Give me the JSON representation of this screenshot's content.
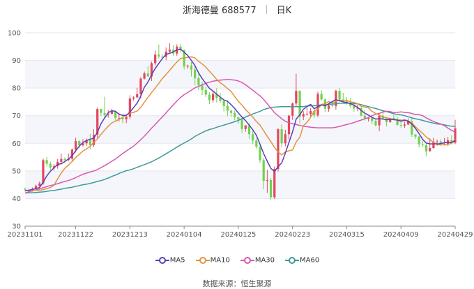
{
  "chart_data": {
    "type": "candlestick",
    "title": "浙海德曼 688577",
    "period_label": "日K",
    "source_text": "数据来源：恒生聚源",
    "ylim": [
      30,
      100
    ],
    "y_ticks": [
      30,
      40,
      50,
      60,
      70,
      80,
      90,
      100
    ],
    "x_ticks": [
      {
        "index": 0,
        "label": "20231101"
      },
      {
        "index": 14,
        "label": "20231122"
      },
      {
        "index": 29,
        "label": "20231213"
      },
      {
        "index": 44,
        "label": "20240104"
      },
      {
        "index": 59,
        "label": "20240125"
      },
      {
        "index": 74,
        "label": "20240223"
      },
      {
        "index": 89,
        "label": "20240315"
      },
      {
        "index": 104,
        "label": "20240409"
      },
      {
        "index": 119,
        "label": "20240429"
      }
    ],
    "grid": "horizontal",
    "legend_position": "bottom",
    "colors": {
      "up": "#e5465b",
      "down": "#6fd24f",
      "ma5": "#5b3db5",
      "ma10": "#e6913b",
      "ma30": "#d958b0",
      "ma60": "#3f9999"
    },
    "legend": [
      {
        "key": "ma5",
        "label": "MA5"
      },
      {
        "key": "ma10",
        "label": "MA10"
      },
      {
        "key": "ma30",
        "label": "MA30"
      },
      {
        "key": "ma60",
        "label": "MA60"
      }
    ],
    "candles": [
      [
        43.5,
        43.2,
        44.0,
        42.5
      ],
      [
        43.2,
        42.8,
        43.6,
        42.2
      ],
      [
        42.8,
        43.5,
        44.0,
        42.5
      ],
      [
        43.5,
        44.6,
        45.1,
        43.2
      ],
      [
        44.6,
        45.5,
        46.2,
        44.0
      ],
      [
        45.5,
        53.9,
        54.5,
        45.0
      ],
      [
        53.9,
        52.6,
        55.1,
        51.6
      ],
      [
        52.6,
        51.2,
        53.4,
        50.3
      ],
      [
        51.2,
        51.7,
        52.5,
        50.2
      ],
      [
        51.7,
        53.3,
        54.3,
        50.8
      ],
      [
        53.3,
        54.3,
        56.3,
        52.4
      ],
      [
        54.3,
        54.0,
        54.9,
        52.8
      ],
      [
        54.0,
        54.4,
        56.3,
        53.5
      ],
      [
        54.4,
        57.7,
        58.2,
        53.8
      ],
      [
        57.7,
        60.8,
        62.0,
        56.7
      ],
      [
        60.8,
        59.3,
        61.1,
        58.2
      ],
      [
        59.3,
        60.0,
        61.5,
        58.8
      ],
      [
        60.0,
        61.1,
        61.7,
        59.1
      ],
      [
        61.1,
        59.4,
        63.4,
        57.9
      ],
      [
        59.4,
        63.1,
        65.1,
        58.6
      ],
      [
        63.1,
        72.4,
        72.9,
        61.9
      ],
      [
        72.4,
        71.0,
        72.6,
        69.9
      ],
      [
        71.0,
        70.3,
        76.9,
        68.9
      ],
      [
        70.3,
        70.6,
        72.0,
        69.3
      ],
      [
        70.6,
        71.6,
        72.5,
        70.6
      ],
      [
        71.6,
        69.2,
        71.7,
        68.3
      ],
      [
        69.2,
        69.2,
        71.0,
        67.9
      ],
      [
        69.2,
        68.7,
        70.6,
        67.3
      ],
      [
        68.7,
        69.6,
        70.4,
        67.3
      ],
      [
        69.6,
        76.2,
        77.4,
        68.7
      ],
      [
        76.2,
        76.6,
        77.0,
        75.5
      ],
      [
        76.6,
        77.8,
        80.1,
        76.6
      ],
      [
        77.8,
        83.4,
        84.0,
        76.2
      ],
      [
        83.4,
        85.3,
        86.0,
        83.1
      ],
      [
        85.3,
        84.2,
        88.0,
        84.0
      ],
      [
        84.2,
        89.0,
        89.5,
        82.6
      ],
      [
        89.0,
        92.1,
        93.7,
        88.3
      ],
      [
        92.1,
        91.4,
        95.8,
        90.6
      ],
      [
        91.4,
        91.3,
        92.2,
        90.4
      ],
      [
        91.3,
        93.2,
        94.7,
        90.1
      ],
      [
        93.2,
        93.9,
        96.2,
        92.8
      ],
      [
        93.9,
        92.5,
        95.6,
        91.7
      ],
      [
        92.5,
        95.0,
        95.8,
        91.7
      ],
      [
        95.0,
        93.7,
        95.9,
        92.9
      ],
      [
        93.7,
        87.8,
        94.0,
        86.7
      ],
      [
        87.8,
        88.1,
        88.5,
        87.0
      ],
      [
        88.1,
        86.7,
        89.4,
        84.2
      ],
      [
        86.7,
        83.6,
        87.8,
        81.0
      ],
      [
        83.6,
        81.0,
        85.6,
        79.3
      ],
      [
        81.0,
        79.3,
        82.3,
        77.5
      ],
      [
        79.3,
        77.6,
        80.5,
        76.8
      ],
      [
        77.6,
        75.6,
        78.5,
        74.2
      ],
      [
        75.6,
        77.9,
        78.8,
        74.7
      ],
      [
        77.9,
        76.5,
        80.0,
        74.8
      ],
      [
        76.5,
        75.3,
        78.3,
        74.7
      ],
      [
        75.3,
        73.5,
        76.3,
        71.5
      ],
      [
        73.5,
        71.8,
        75.5,
        69.8
      ],
      [
        71.8,
        71.0,
        72.1,
        69.6
      ],
      [
        71.0,
        69.4,
        71.9,
        68.3
      ],
      [
        69.4,
        68.6,
        69.5,
        67.0
      ],
      [
        68.6,
        65.2,
        69.2,
        63.7
      ],
      [
        65.2,
        66.5,
        66.5,
        64.2
      ],
      [
        66.5,
        63.3,
        67.3,
        61.6
      ],
      [
        63.3,
        61.0,
        64.5,
        59.7
      ],
      [
        61.0,
        58.8,
        61.8,
        58.0
      ],
      [
        58.8,
        53.9,
        59.6,
        53.0
      ],
      [
        53.9,
        46.4,
        54.7,
        43.4
      ],
      [
        46.4,
        46.7,
        50.4,
        42.1
      ],
      [
        46.7,
        40.5,
        47.4,
        39.6
      ],
      [
        40.5,
        50.7,
        51.6,
        39.8
      ],
      [
        50.7,
        65.1,
        65.4,
        49.8
      ],
      [
        65.1,
        60.0,
        66.8,
        58.6
      ],
      [
        60.0,
        63.3,
        64.9,
        58.9
      ],
      [
        63.3,
        70.0,
        70.4,
        61.5
      ],
      [
        70.0,
        74.4,
        74.8,
        68.5
      ],
      [
        74.4,
        79.0,
        85.2,
        73.4
      ],
      [
        79.0,
        69.7,
        79.2,
        67.1
      ],
      [
        69.7,
        70.6,
        71.6,
        68.4
      ],
      [
        70.6,
        70.6,
        72.8,
        70.1
      ],
      [
        70.6,
        71.7,
        72.7,
        69.3
      ],
      [
        71.7,
        70.1,
        72.1,
        69.2
      ],
      [
        70.1,
        77.9,
        78.7,
        69.4
      ],
      [
        77.9,
        75.9,
        79.2,
        75.3
      ],
      [
        75.9,
        72.5,
        76.3,
        71.2
      ],
      [
        72.5,
        73.7,
        74.2,
        71.4
      ],
      [
        73.7,
        73.5,
        75.0,
        73.1
      ],
      [
        73.5,
        79.0,
        79.4,
        72.2
      ],
      [
        79.0,
        75.9,
        80.1,
        74.9
      ],
      [
        75.9,
        75.6,
        78.3,
        75.1
      ],
      [
        75.6,
        74.4,
        76.8,
        74.1
      ],
      [
        74.4,
        73.6,
        76.4,
        72.9
      ],
      [
        73.6,
        72.6,
        74.3,
        71.4
      ],
      [
        72.6,
        72.8,
        73.9,
        71.6
      ],
      [
        72.8,
        70.0,
        73.1,
        69.7
      ],
      [
        70.0,
        69.1,
        72.1,
        68.2
      ],
      [
        69.1,
        69.2,
        69.6,
        67.9
      ],
      [
        69.2,
        68.1,
        69.4,
        67.0
      ],
      [
        68.1,
        66.5,
        68.6,
        66.1
      ],
      [
        66.5,
        70.0,
        70.5,
        64.4
      ],
      [
        70.0,
        69.0,
        72.0,
        68.9
      ],
      [
        69.0,
        67.7,
        69.4,
        66.2
      ],
      [
        67.7,
        69.2,
        69.2,
        67.4
      ],
      [
        69.2,
        68.8,
        70.3,
        68.4
      ],
      [
        68.8,
        66.6,
        69.5,
        66.5
      ],
      [
        66.6,
        66.4,
        68.6,
        65.7
      ],
      [
        66.4,
        66.8,
        68.0,
        65.6
      ],
      [
        66.8,
        67.9,
        69.0,
        66.6
      ],
      [
        67.9,
        63.2,
        69.4,
        62.3
      ],
      [
        63.2,
        62.4,
        63.3,
        61.6
      ],
      [
        62.4,
        59.6,
        62.7,
        58.5
      ],
      [
        59.6,
        59.3,
        60.9,
        58.6
      ],
      [
        59.3,
        57.1,
        60.0,
        55.3
      ],
      [
        57.1,
        58.3,
        61.8,
        57.0
      ],
      [
        58.3,
        60.6,
        62.0,
        58.0
      ],
      [
        60.6,
        60.7,
        61.4,
        59.1
      ],
      [
        60.7,
        59.8,
        61.5,
        59.6
      ],
      [
        59.8,
        59.8,
        61.8,
        59.2
      ],
      [
        59.8,
        61.1,
        62.3,
        59.0
      ],
      [
        61.1,
        60.2,
        63.0,
        59.6
      ],
      [
        60.2,
        65.4,
        68.5,
        59.7
      ]
    ],
    "ma5": [
      42.9,
      43.0,
      43.3,
      43.6,
      44.0,
      45.9,
      48.2,
      49.9,
      51.1,
      52.4,
      52.6,
      53.4,
      54.3,
      55.5,
      57.3,
      59.0,
      60.3,
      61.0,
      61.5,
      61.8,
      64.0,
      67.1,
      69.2,
      71.1,
      71.8,
      71.6,
      70.5,
      70.1,
      70.1,
      71.3,
      72.9,
      74.5,
      77.1,
      80.3,
      82.2,
      84.8,
      87.1,
      88.9,
      90.7,
      92.2,
      92.6,
      93.1,
      93.8,
      94.1,
      93.0,
      91.8,
      90.0,
      88.1,
      85.5,
      83.4,
      81.7,
      79.9,
      78.9,
      77.8,
      76.7,
      75.7,
      75.2,
      74.0,
      72.6,
      71.0,
      69.5,
      68.2,
      66.6,
      64.9,
      62.9,
      59.7,
      56.3,
      53.5,
      50.9,
      49.8,
      51.5,
      52.9,
      56.4,
      60.3,
      64.2,
      68.8,
      70.3,
      72.3,
      73.3,
      74.1,
      72.5,
      73.3,
      73.9,
      73.6,
      74.3,
      75.1,
      75.8,
      75.4,
      75.0,
      74.7,
      74.4,
      73.8,
      73.0,
      71.9,
      70.9,
      70.2,
      69.4,
      68.8,
      68.9,
      68.8,
      68.5,
      68.7,
      68.6,
      68.4,
      68.0,
      68.4,
      68.0,
      67.0,
      65.4,
      63.5,
      61.4,
      60.1,
      59.8,
      59.8,
      59.8,
      59.9,
      60.2,
      60.4,
      60.3,
      60.9
    ],
    "ma10": [
      42.9,
      43.0,
      43.0,
      43.0,
      43.0,
      43.2,
      43.6,
      44.0,
      44.8,
      47.1,
      49.2,
      51.0,
      52.1,
      53.4,
      54.9,
      56.0,
      57.2,
      58.0,
      58.9,
      60.3,
      61.6,
      63.2,
      64.8,
      66.2,
      67.4,
      68.0,
      68.7,
      69.4,
      70.3,
      70.9,
      71.2,
      71.7,
      73.0,
      74.9,
      76.6,
      78.4,
      80.0,
      81.7,
      83.5,
      84.9,
      86.4,
      88.0,
      89.4,
      90.7,
      90.9,
      91.1,
      91.3,
      90.9,
      89.7,
      88.7,
      87.6,
      86.1,
      84.7,
      83.1,
      81.9,
      81.0,
      79.8,
      78.8,
      76.9,
      75.2,
      73.8,
      72.2,
      70.9,
      69.5,
      67.9,
      66.6,
      64.6,
      62.5,
      60.6,
      58.5,
      56.9,
      55.8,
      56.9,
      57.3,
      57.6,
      60.5,
      62.2,
      66.4,
      67.6,
      69.4,
      71.7,
      72.4,
      74.1,
      74.3,
      75.1,
      74.6,
      75.2,
      75.7,
      75.3,
      75.5,
      75.0,
      74.8,
      74.3,
      73.4,
      73.1,
      72.8,
      71.6,
      70.8,
      70.2,
      69.5,
      69.3,
      68.9,
      68.5,
      68.5,
      68.4,
      68.4,
      68.2,
      67.4,
      66.0,
      64.7,
      63.6,
      62.3,
      61.3,
      60.4,
      59.6,
      59.4,
      59.6,
      59.6,
      60.0,
      61.5
    ],
    "ma30": [
      42.0,
      42.4,
      42.8,
      43.1,
      43.5,
      43.9,
      44.3,
      44.7,
      45.0,
      45.4,
      45.8,
      46.2,
      46.5,
      47.0,
      47.6,
      48.2,
      48.8,
      49.2,
      49.6,
      50.0,
      50.5,
      51.2,
      51.9,
      52.7,
      53.5,
      54.3,
      55.3,
      56.3,
      57.2,
      58.1,
      58.9,
      60.1,
      61.3,
      62.6,
      64.0,
      65.5,
      66.8,
      68.2,
      69.6,
      71.0,
      72.5,
      73.9,
      75.3,
      76.6,
      77.6,
      78.4,
      79.2,
      80.1,
      80.6,
      81.2,
      81.7,
      82.1,
      82.5,
      82.7,
      82.9,
      83.0,
      83.1,
      83.0,
      82.9,
      82.6,
      82.0,
      81.2,
      80.2,
      79.2,
      78.2,
      77.2,
      75.9,
      74.3,
      72.7,
      71.1,
      70.0,
      68.9,
      68.0,
      67.4,
      67.1,
      66.8,
      66.5,
      66.2,
      66.0,
      65.8,
      65.7,
      65.6,
      65.6,
      65.6,
      65.6,
      65.6,
      65.8,
      66.1,
      66.5,
      66.8,
      67.1,
      67.5,
      68.0,
      68.4,
      68.9,
      69.3,
      70.0,
      70.5,
      70.8,
      71.3,
      71.6,
      71.5,
      71.1,
      71.2,
      71.4,
      71.2,
      71.1,
      70.8,
      70.4,
      70.4,
      70.0,
      69.2,
      68.5,
      67.9,
      67.4,
      67.0,
      66.4,
      65.5,
      64.7,
      64.0
    ],
    "ma60": [
      42.0,
      42.1,
      42.1,
      42.2,
      42.3,
      42.4,
      42.6,
      42.8,
      42.9,
      43.2,
      43.4,
      43.7,
      43.9,
      44.1,
      44.4,
      44.7,
      45.0,
      45.2,
      45.5,
      45.8,
      46.2,
      46.5,
      46.9,
      47.4,
      48.0,
      48.5,
      49.1,
      49.6,
      50.1,
      50.4,
      50.8,
      51.3,
      51.8,
      52.3,
      52.8,
      53.3,
      54.0,
      54.7,
      55.4,
      56.2,
      57.0,
      57.8,
      58.6,
      59.4,
      60.1,
      60.8,
      61.6,
      62.5,
      63.2,
      63.9,
      64.5,
      65.0,
      65.3,
      65.8,
      66.2,
      66.6,
      67.0,
      67.4,
      67.8,
      68.3,
      68.9,
      69.5,
      70.1,
      70.6,
      71.1,
      71.6,
      72.2,
      72.6,
      72.9,
      73.1,
      73.2,
      73.3,
      73.3,
      73.3,
      73.2,
      73.3,
      73.3,
      73.3,
      73.5,
      73.6,
      73.6,
      73.8,
      73.9,
      73.9,
      74.1,
      74.2,
      74.3,
      74.5,
      74.5,
      74.5,
      74.5,
      74.4,
      74.3,
      74.0,
      73.6,
      73.3,
      72.9,
      72.6,
      72.2,
      71.8,
      71.5,
      71.1,
      70.7,
      70.4,
      70.3,
      70.0,
      69.6,
      69.2,
      68.9,
      68.6,
      68.3,
      67.9,
      67.6,
      67.3,
      67.0,
      66.9,
      66.7,
      66.4,
      66.2,
      66.1
    ]
  }
}
